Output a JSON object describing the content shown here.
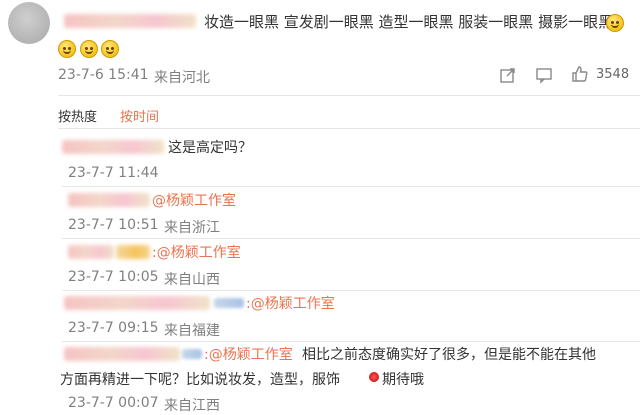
{
  "post": {
    "content": "妆造一眼黑 宣发剧一眼黑 造型一眼黑 服装一眼黑 摄影一眼黑",
    "timestamp": "23-7-6 15:41",
    "location": "来自河北",
    "like_count": "3548",
    "icons": [
      "share-icon",
      "comment-icon",
      "like-icon"
    ]
  },
  "sort": {
    "by_hot": "按热度",
    "by_time": "按时间"
  },
  "comments": [
    {
      "content": "这是高定吗？",
      "mention": "",
      "timestamp": "23-7-7 11:44",
      "location": ""
    },
    {
      "content": "",
      "mention": "@杨颖工作室",
      "timestamp": "23-7-7 10:51",
      "location": "来自浙江"
    },
    {
      "content": "",
      "mention": ":@杨颖工作室",
      "timestamp": "23-7-7 10:05",
      "location": "来自山西"
    },
    {
      "content": "",
      "mention": ":@杨颖工作室",
      "timestamp": "23-7-7 09:15",
      "location": "来自福建"
    },
    {
      "content_line1": "相比之前态度确实好了很多，但是能不能在其他",
      "content_line2": "方面再精进一下呢？比如说妆发，造型，服饰",
      "content_line2_end": "期待哦",
      "mention": ":@杨颖工作室",
      "timestamp": "23-7-7 00:07",
      "location": "来自江西"
    }
  ],
  "colors": {
    "accent": "#eb7350",
    "meta": "#808080",
    "text": "#333333"
  }
}
